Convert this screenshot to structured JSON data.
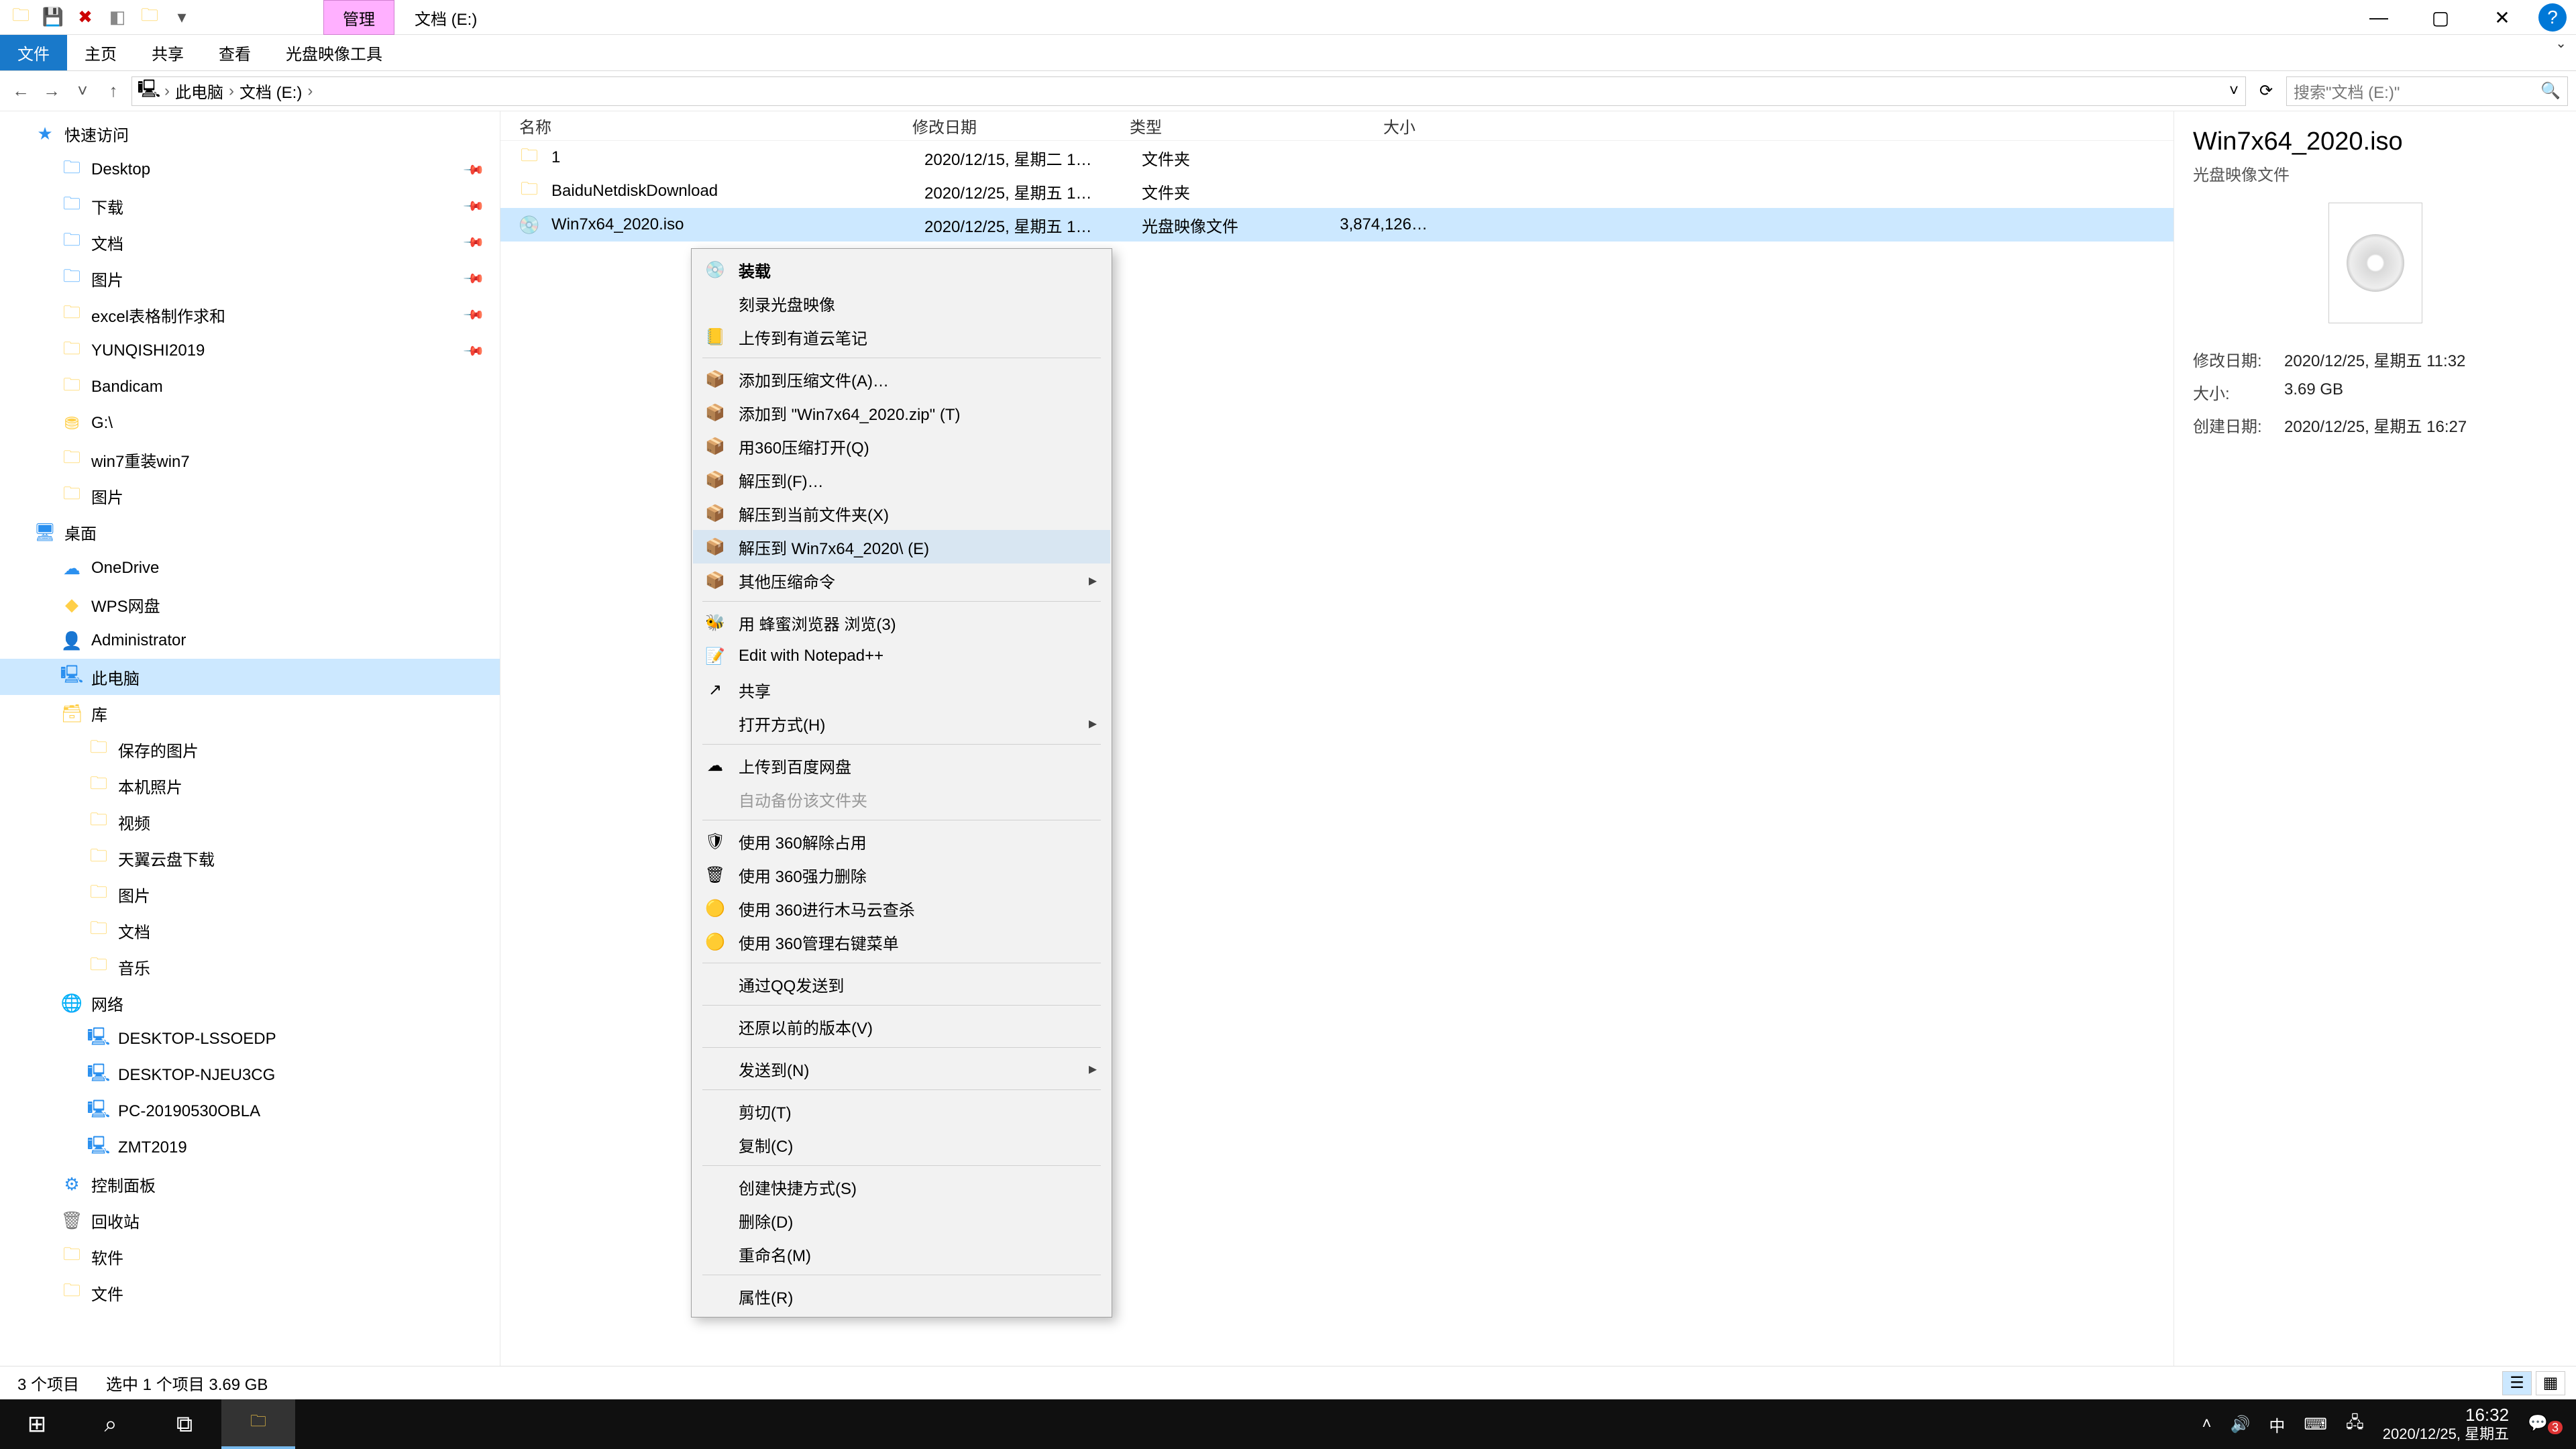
{
  "qat_icons": [
    "folder-icon",
    "save-icon",
    "delete-icon",
    "props-icon",
    "newfolder-icon",
    "dropdown-icon"
  ],
  "context_tab": "管理",
  "window_title": "文档 (E:)",
  "ribbon": {
    "tabs": [
      "文件",
      "主页",
      "共享",
      "查看",
      "光盘映像工具"
    ],
    "active": 0
  },
  "nav": {
    "back": "←",
    "fwd": "→",
    "up": "↑"
  },
  "crumbs": [
    "此电脑",
    "文档 (E:)"
  ],
  "search_placeholder": "搜索\"文档 (E:)\"",
  "tree": [
    {
      "label": "快速访问",
      "depth": 0,
      "icon": "star"
    },
    {
      "label": "Desktop",
      "depth": 1,
      "icon": "folder-blue",
      "pin": true
    },
    {
      "label": "下载",
      "depth": 1,
      "icon": "folder-blue",
      "pin": true
    },
    {
      "label": "文档",
      "depth": 1,
      "icon": "folder-blue",
      "pin": true
    },
    {
      "label": "图片",
      "depth": 1,
      "icon": "folder-blue",
      "pin": true
    },
    {
      "label": "excel表格制作求和",
      "depth": 1,
      "icon": "folder",
      "pin": true
    },
    {
      "label": "YUNQISHI2019",
      "depth": 1,
      "icon": "folder",
      "pin": true
    },
    {
      "label": "Bandicam",
      "depth": 1,
      "icon": "folder"
    },
    {
      "label": "G:\\",
      "depth": 1,
      "icon": "drive"
    },
    {
      "label": "win7重装win7",
      "depth": 1,
      "icon": "folder"
    },
    {
      "label": "图片",
      "depth": 1,
      "icon": "folder"
    },
    {
      "label": "桌面",
      "depth": 0,
      "icon": "desktop"
    },
    {
      "label": "OneDrive",
      "depth": 1,
      "icon": "cloud"
    },
    {
      "label": "WPS网盘",
      "depth": 1,
      "icon": "wps"
    },
    {
      "label": "Administrator",
      "depth": 1,
      "icon": "user"
    },
    {
      "label": "此电脑",
      "depth": 1,
      "icon": "pc",
      "selected": true
    },
    {
      "label": "库",
      "depth": 1,
      "icon": "lib"
    },
    {
      "label": "保存的图片",
      "depth": 2,
      "icon": "folder"
    },
    {
      "label": "本机照片",
      "depth": 2,
      "icon": "folder"
    },
    {
      "label": "视频",
      "depth": 2,
      "icon": "folder"
    },
    {
      "label": "天翼云盘下载",
      "depth": 2,
      "icon": "folder"
    },
    {
      "label": "图片",
      "depth": 2,
      "icon": "folder"
    },
    {
      "label": "文档",
      "depth": 2,
      "icon": "folder"
    },
    {
      "label": "音乐",
      "depth": 2,
      "icon": "folder"
    },
    {
      "label": "网络",
      "depth": 1,
      "icon": "net"
    },
    {
      "label": "DESKTOP-LSSOEDP",
      "depth": 2,
      "icon": "pc"
    },
    {
      "label": "DESKTOP-NJEU3CG",
      "depth": 2,
      "icon": "pc"
    },
    {
      "label": "PC-20190530OBLA",
      "depth": 2,
      "icon": "pc"
    },
    {
      "label": "ZMT2019",
      "depth": 2,
      "icon": "pc"
    },
    {
      "label": "控制面板",
      "depth": 1,
      "icon": "ctrl"
    },
    {
      "label": "回收站",
      "depth": 1,
      "icon": "bin"
    },
    {
      "label": "软件",
      "depth": 1,
      "icon": "folder"
    },
    {
      "label": "文件",
      "depth": 1,
      "icon": "folder"
    }
  ],
  "columns": {
    "name": "名称",
    "mod": "修改日期",
    "type": "类型",
    "size": "大小"
  },
  "rows": [
    {
      "name": "1",
      "mod": "2020/12/15, 星期二 1…",
      "type": "文件夹",
      "size": "",
      "icon": "folder"
    },
    {
      "name": "BaiduNetdiskDownload",
      "mod": "2020/12/25, 星期五 1…",
      "type": "文件夹",
      "size": "",
      "icon": "folder"
    },
    {
      "name": "Win7x64_2020.iso",
      "mod": "2020/12/25, 星期五 1…",
      "type": "光盘映像文件",
      "size": "3,874,126…",
      "icon": "iso",
      "selected": true
    }
  ],
  "details": {
    "title": "Win7x64_2020.iso",
    "subtitle": "光盘映像文件",
    "props": [
      {
        "k": "修改日期:",
        "v": "2020/12/25, 星期五 11:32"
      },
      {
        "k": "大小:",
        "v": "3.69 GB"
      },
      {
        "k": "创建日期:",
        "v": "2020/12/25, 星期五 16:27"
      }
    ]
  },
  "context_menu": [
    {
      "label": "装载",
      "bold": true,
      "icon": "disc"
    },
    {
      "label": "刻录光盘映像"
    },
    {
      "label": "上传到有道云笔记",
      "icon": "note"
    },
    {
      "sep": true
    },
    {
      "label": "添加到压缩文件(A)…",
      "icon": "zip"
    },
    {
      "label": "添加到 \"Win7x64_2020.zip\" (T)",
      "icon": "zip"
    },
    {
      "label": "用360压缩打开(Q)",
      "icon": "zip"
    },
    {
      "label": "解压到(F)…",
      "icon": "zip"
    },
    {
      "label": "解压到当前文件夹(X)",
      "icon": "zip"
    },
    {
      "label": "解压到 Win7x64_2020\\ (E)",
      "icon": "zip",
      "hover": true
    },
    {
      "label": "其他压缩命令",
      "icon": "zip",
      "sub": true
    },
    {
      "sep": true
    },
    {
      "label": "用 蜂蜜浏览器 浏览(3)",
      "icon": "bee"
    },
    {
      "label": "Edit with Notepad++",
      "icon": "npp"
    },
    {
      "label": "共享",
      "icon": "share"
    },
    {
      "label": "打开方式(H)",
      "sub": true
    },
    {
      "sep": true
    },
    {
      "label": "上传到百度网盘",
      "icon": "baidu"
    },
    {
      "label": "自动备份该文件夹",
      "disabled": true
    },
    {
      "sep": true
    },
    {
      "label": "使用 360解除占用",
      "icon": "s360a"
    },
    {
      "label": "使用 360强力删除",
      "icon": "s360b"
    },
    {
      "label": "使用 360进行木马云查杀",
      "icon": "s360c"
    },
    {
      "label": "使用 360管理右键菜单",
      "icon": "s360c"
    },
    {
      "sep": true
    },
    {
      "label": "通过QQ发送到"
    },
    {
      "sep": true
    },
    {
      "label": "还原以前的版本(V)"
    },
    {
      "sep": true
    },
    {
      "label": "发送到(N)",
      "sub": true
    },
    {
      "sep": true
    },
    {
      "label": "剪切(T)"
    },
    {
      "label": "复制(C)"
    },
    {
      "sep": true
    },
    {
      "label": "创建快捷方式(S)"
    },
    {
      "label": "删除(D)"
    },
    {
      "label": "重命名(M)"
    },
    {
      "sep": true
    },
    {
      "label": "属性(R)"
    }
  ],
  "status": {
    "count": "3 个项目",
    "sel": "选中 1 个项目  3.69 GB"
  },
  "taskbar": {
    "time": "16:32",
    "date": "2020/12/25, 星期五",
    "ime": "中",
    "badge": "3"
  }
}
